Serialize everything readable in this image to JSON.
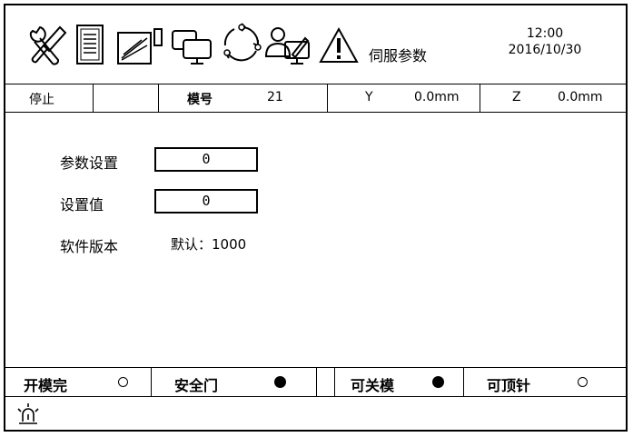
{
  "toolbar": {
    "icons": [
      "tools-icon",
      "document-icon",
      "notepad-icon",
      "monitors-icon",
      "cycle-icon",
      "operator-icon",
      "warning-icon"
    ],
    "title": "伺服参数",
    "time": "12:00",
    "date": "2016/10/30"
  },
  "status": {
    "state": "停止",
    "blank": "",
    "mold_label": "模号",
    "mold_value": "21",
    "y_label": "Y",
    "y_value": "0.0mm",
    "z_label": "Z",
    "z_value": "0.0mm"
  },
  "form": {
    "param_label": "参数设置",
    "param_value": "0",
    "setvalue_label": "设置值",
    "setvalue_value": "0",
    "version_label": "软件版本",
    "version_value": "默认：1000"
  },
  "signals": [
    {
      "label": "开模完",
      "on": false
    },
    {
      "label": "安全门",
      "on": true
    },
    {
      "label": "可关模",
      "on": true
    },
    {
      "label": "可顶针",
      "on": false
    }
  ],
  "colors": {
    "line": "#000000",
    "background": "#ffffff"
  }
}
